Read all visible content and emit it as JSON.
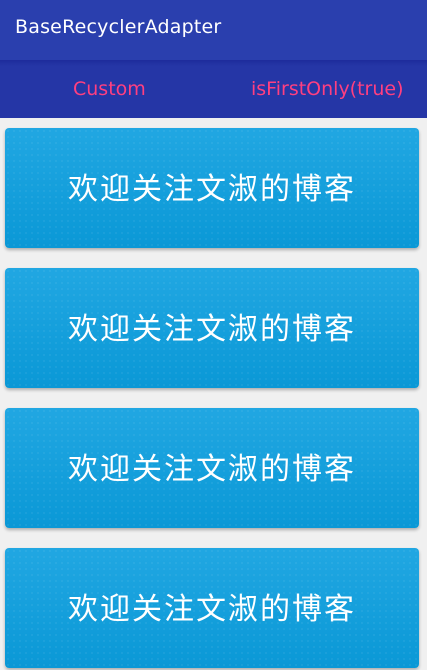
{
  "app": {
    "title": "BaseRecyclerAdapter"
  },
  "toolbar": {
    "custom_label": "Custom",
    "first_only_label": "isFirstOnly(true)",
    "accent_color": "#ff3f80"
  },
  "list": {
    "items": [
      {
        "text": "欢迎关注文淑的博客"
      },
      {
        "text": "欢迎关注文淑的博客"
      },
      {
        "text": "欢迎关注文淑的博客"
      },
      {
        "text": "欢迎关注文淑的博客"
      }
    ]
  },
  "colors": {
    "appbar": "#2a3fae",
    "card": "#0ea0dc",
    "background": "#f0f0f0"
  }
}
